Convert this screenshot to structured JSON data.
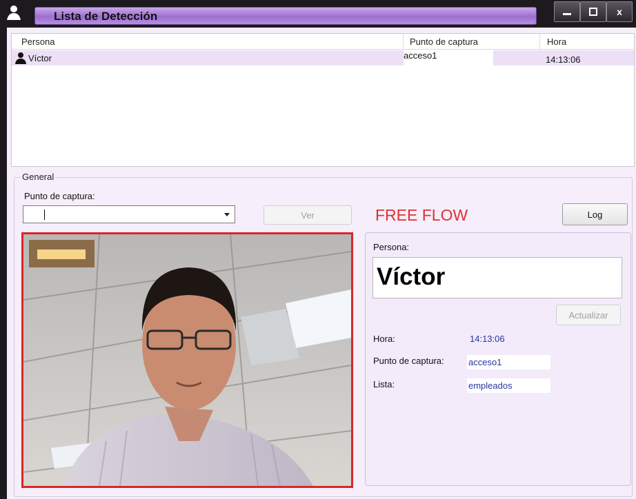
{
  "window": {
    "title": "Lista de Detección",
    "icons": {
      "app": "person-icon",
      "minimize": "minimize-icon",
      "maximize": "maximize-icon",
      "close": "close-icon"
    },
    "buttons": {
      "close_glyph": "x"
    }
  },
  "detection_list": {
    "columns": [
      "Persona",
      "Punto de captura",
      "Hora"
    ],
    "rows": [
      {
        "persona": "Víctor",
        "punto_de_captura": "acceso1",
        "hora": "14:13:06",
        "icon": "person-icon"
      }
    ]
  },
  "general": {
    "legend": "General",
    "punto_de_captura_label": "Punto de captura:",
    "punto_de_captura_value": "",
    "ver_button": "Ver",
    "mode": "FREE FLOW",
    "log_button": "Log",
    "camera_feed": "camera-feed-image",
    "details": {
      "persona_label": "Persona:",
      "persona_value": "Víctor",
      "actualizar_button": "Actualizar",
      "hora_label": "Hora:",
      "hora_value": "14:13:06",
      "punto_label": "Punto de captura:",
      "punto_value": "acceso1",
      "lista_label": "Lista:",
      "lista_value": "empleados"
    }
  },
  "colors": {
    "accent_title": "#b58fe0",
    "mode_red": "#e03030",
    "camera_border": "#d92626",
    "value_blue": "#2b35a0",
    "row_highlight": "#ecdff6"
  }
}
